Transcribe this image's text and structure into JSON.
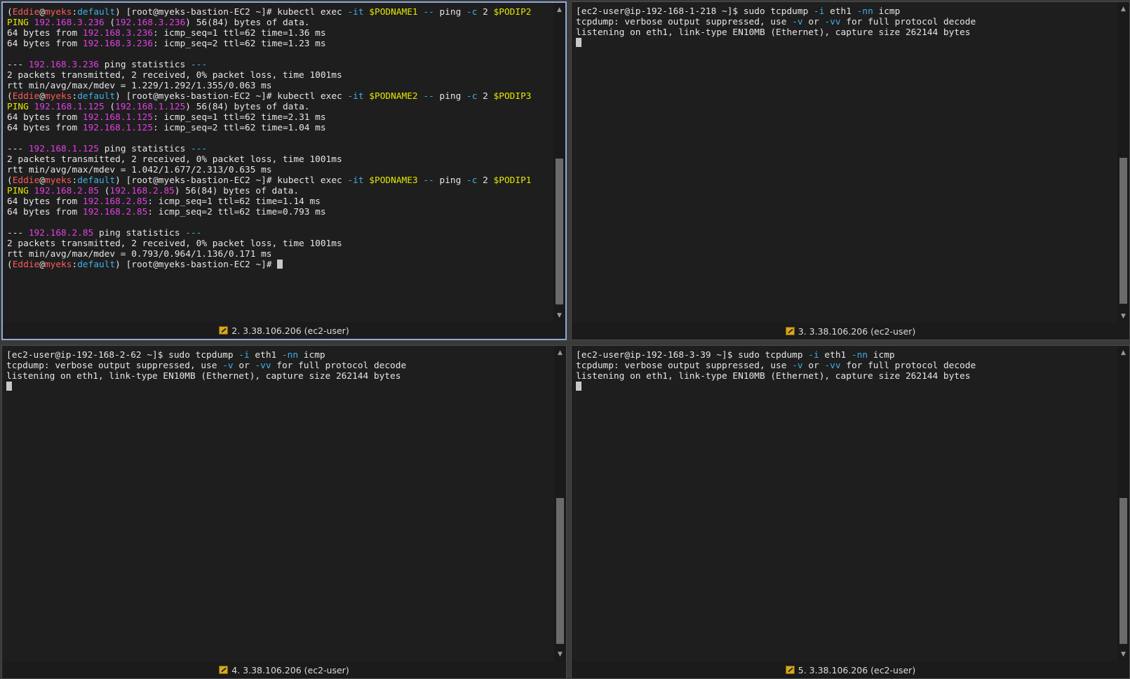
{
  "panes": {
    "p2": {
      "title": "2. 3.38.106.206 (ec2-user)",
      "lines": [
        [
          [
            "(",
            ""
          ],
          [
            "Eddie",
            "c-red"
          ],
          [
            "@",
            ""
          ],
          [
            "myeks",
            "c-red"
          ],
          [
            ":",
            ""
          ],
          [
            "default",
            "c-cyan"
          ],
          [
            ") [root@myeks-bastion-EC2 ~]# kubectl exec ",
            ""
          ],
          [
            "-it",
            "c-cyan"
          ],
          [
            " ",
            ""
          ],
          [
            "$PODNAME1",
            "c-yel"
          ],
          [
            " ",
            ""
          ],
          [
            "--",
            "c-cyan"
          ],
          [
            " ping ",
            ""
          ],
          [
            "-c",
            "c-cyan"
          ],
          [
            " 2 ",
            ""
          ],
          [
            "$PODIP2",
            "c-yel"
          ]
        ],
        [
          [
            "PING ",
            "c-yel"
          ],
          [
            "192.168.3.236",
            "c-mag"
          ],
          [
            " (",
            ""
          ],
          [
            "192.168.3.236",
            "c-mag"
          ],
          [
            ") 56(84) bytes of data.",
            ""
          ]
        ],
        [
          [
            "64 bytes from ",
            ""
          ],
          [
            "192.168.3.236",
            "c-mag"
          ],
          [
            ": icmp_seq=1 ttl=62 time=1.36 ms",
            ""
          ]
        ],
        [
          [
            "64 bytes from ",
            ""
          ],
          [
            "192.168.3.236",
            "c-mag"
          ],
          [
            ": icmp_seq=2 ttl=62 time=1.23 ms",
            ""
          ]
        ],
        [
          [
            "",
            ""
          ]
        ],
        [
          [
            "--- ",
            ""
          ],
          [
            "192.168.3.236",
            "c-mag"
          ],
          [
            " ping statistics ",
            ""
          ],
          [
            "---",
            "c-cyan"
          ]
        ],
        [
          [
            "2 packets transmitted, 2 received, 0% packet loss, time 1001ms",
            ""
          ]
        ],
        [
          [
            "rtt min/avg/max/mdev = 1.229/1.292/1.355/0.063 ms",
            ""
          ]
        ],
        [
          [
            "(",
            ""
          ],
          [
            "Eddie",
            "c-red"
          ],
          [
            "@",
            ""
          ],
          [
            "myeks",
            "c-red"
          ],
          [
            ":",
            ""
          ],
          [
            "default",
            "c-cyan"
          ],
          [
            ") [root@myeks-bastion-EC2 ~]# kubectl exec ",
            ""
          ],
          [
            "-it",
            "c-cyan"
          ],
          [
            " ",
            ""
          ],
          [
            "$PODNAME2",
            "c-yel"
          ],
          [
            " ",
            ""
          ],
          [
            "--",
            "c-cyan"
          ],
          [
            " ping ",
            ""
          ],
          [
            "-c",
            "c-cyan"
          ],
          [
            " 2 ",
            ""
          ],
          [
            "$PODIP3",
            "c-yel"
          ]
        ],
        [
          [
            "PING ",
            "c-yel"
          ],
          [
            "192.168.1.125",
            "c-mag"
          ],
          [
            " (",
            ""
          ],
          [
            "192.168.1.125",
            "c-mag"
          ],
          [
            ") 56(84) bytes of data.",
            ""
          ]
        ],
        [
          [
            "64 bytes from ",
            ""
          ],
          [
            "192.168.1.125",
            "c-mag"
          ],
          [
            ": icmp_seq=1 ttl=62 time=2.31 ms",
            ""
          ]
        ],
        [
          [
            "64 bytes from ",
            ""
          ],
          [
            "192.168.1.125",
            "c-mag"
          ],
          [
            ": icmp_seq=2 ttl=62 time=1.04 ms",
            ""
          ]
        ],
        [
          [
            "",
            ""
          ]
        ],
        [
          [
            "--- ",
            ""
          ],
          [
            "192.168.1.125",
            "c-mag"
          ],
          [
            " ping statistics ",
            ""
          ],
          [
            "---",
            "c-cyan"
          ]
        ],
        [
          [
            "2 packets transmitted, 2 received, 0% packet loss, time 1001ms",
            ""
          ]
        ],
        [
          [
            "rtt min/avg/max/mdev = 1.042/1.677/2.313/0.635 ms",
            ""
          ]
        ],
        [
          [
            "(",
            ""
          ],
          [
            "Eddie",
            "c-red"
          ],
          [
            "@",
            ""
          ],
          [
            "myeks",
            "c-red"
          ],
          [
            ":",
            ""
          ],
          [
            "default",
            "c-cyan"
          ],
          [
            ") [root@myeks-bastion-EC2 ~]# kubectl exec ",
            ""
          ],
          [
            "-it",
            "c-cyan"
          ],
          [
            " ",
            ""
          ],
          [
            "$PODNAME3",
            "c-yel"
          ],
          [
            " ",
            ""
          ],
          [
            "--",
            "c-cyan"
          ],
          [
            " ping ",
            ""
          ],
          [
            "-c",
            "c-cyan"
          ],
          [
            " 2 ",
            ""
          ],
          [
            "$PODIP1",
            "c-yel"
          ]
        ],
        [
          [
            "PING ",
            "c-yel"
          ],
          [
            "192.168.2.85",
            "c-mag"
          ],
          [
            " (",
            ""
          ],
          [
            "192.168.2.85",
            "c-mag"
          ],
          [
            ") 56(84) bytes of data.",
            ""
          ]
        ],
        [
          [
            "64 bytes from ",
            ""
          ],
          [
            "192.168.2.85",
            "c-mag"
          ],
          [
            ": icmp_seq=1 ttl=62 time=1.14 ms",
            ""
          ]
        ],
        [
          [
            "64 bytes from ",
            ""
          ],
          [
            "192.168.2.85",
            "c-mag"
          ],
          [
            ": icmp_seq=2 ttl=62 time=0.793 ms",
            ""
          ]
        ],
        [
          [
            "",
            ""
          ]
        ],
        [
          [
            "--- ",
            ""
          ],
          [
            "192.168.2.85",
            "c-mag"
          ],
          [
            " ping statistics ",
            ""
          ],
          [
            "---",
            "c-cyan"
          ]
        ],
        [
          [
            "2 packets transmitted, 2 received, 0% packet loss, time 1001ms",
            ""
          ]
        ],
        [
          [
            "rtt min/avg/max/mdev = 0.793/0.964/1.136/0.171 ms",
            ""
          ]
        ],
        [
          [
            "(",
            ""
          ],
          [
            "Eddie",
            "c-red"
          ],
          [
            "@",
            ""
          ],
          [
            "myeks",
            "c-red"
          ],
          [
            ":",
            ""
          ],
          [
            "default",
            "c-cyan"
          ],
          [
            ") [root@myeks-bastion-EC2 ~]# ",
            ""
          ],
          [
            "",
            "cursor"
          ]
        ]
      ]
    },
    "p3": {
      "title": "3. 3.38.106.206 (ec2-user)",
      "lines": [
        [
          [
            "[ec2-user@ip-192-168-1-218 ~]$ sudo tcpdump ",
            ""
          ],
          [
            "-i",
            "c-cyan"
          ],
          [
            " eth1 ",
            ""
          ],
          [
            "-nn",
            "c-cyan"
          ],
          [
            " icmp",
            ""
          ]
        ],
        [
          [
            "tcpdump: verbose output suppressed, use ",
            ""
          ],
          [
            "-v",
            "c-cyan"
          ],
          [
            " or ",
            ""
          ],
          [
            "-vv",
            "c-cyan"
          ],
          [
            " for full protocol decode",
            ""
          ]
        ],
        [
          [
            "listening on eth1, link-type EN10MB (Ethernet), capture size 262144 bytes",
            ""
          ]
        ],
        [
          [
            "",
            "cursor"
          ]
        ]
      ]
    },
    "p4": {
      "title": "4. 3.38.106.206 (ec2-user)",
      "lines": [
        [
          [
            "[ec2-user@ip-192-168-2-62 ~]$ sudo tcpdump ",
            ""
          ],
          [
            "-i",
            "c-cyan"
          ],
          [
            " eth1 ",
            ""
          ],
          [
            "-nn",
            "c-cyan"
          ],
          [
            " icmp",
            ""
          ]
        ],
        [
          [
            "tcpdump: verbose output suppressed, use ",
            ""
          ],
          [
            "-v",
            "c-cyan"
          ],
          [
            " or ",
            ""
          ],
          [
            "-vv",
            "c-cyan"
          ],
          [
            " for full protocol decode",
            ""
          ]
        ],
        [
          [
            "listening on eth1, link-type EN10MB (Ethernet), capture size 262144 bytes",
            ""
          ]
        ],
        [
          [
            "",
            "cursor"
          ]
        ]
      ]
    },
    "p5": {
      "title": "5. 3.38.106.206 (ec2-user)",
      "lines": [
        [
          [
            "[ec2-user@ip-192-168-3-39 ~]$ sudo tcpdump ",
            ""
          ],
          [
            "-i",
            "c-cyan"
          ],
          [
            " eth1 ",
            ""
          ],
          [
            "-nn",
            "c-cyan"
          ],
          [
            " icmp",
            ""
          ]
        ],
        [
          [
            "tcpdump: verbose output suppressed, use ",
            ""
          ],
          [
            "-v",
            "c-cyan"
          ],
          [
            " or ",
            ""
          ],
          [
            "-vv",
            "c-cyan"
          ],
          [
            " for full protocol decode",
            ""
          ]
        ],
        [
          [
            "listening on eth1, link-type EN10MB (Ethernet), capture size 262144 bytes",
            ""
          ]
        ],
        [
          [
            "",
            "cursor"
          ]
        ]
      ]
    }
  },
  "icons": {
    "status": "key-icon",
    "scroll_up": "arrow-up-icon",
    "scroll_down": "arrow-down-icon"
  },
  "colors": {
    "red": "#ff5a5a",
    "magenta": "#e43fe4",
    "yellow": "#e6e600",
    "cyan": "#3fb0e6",
    "active_border": "#8fa9d6"
  }
}
